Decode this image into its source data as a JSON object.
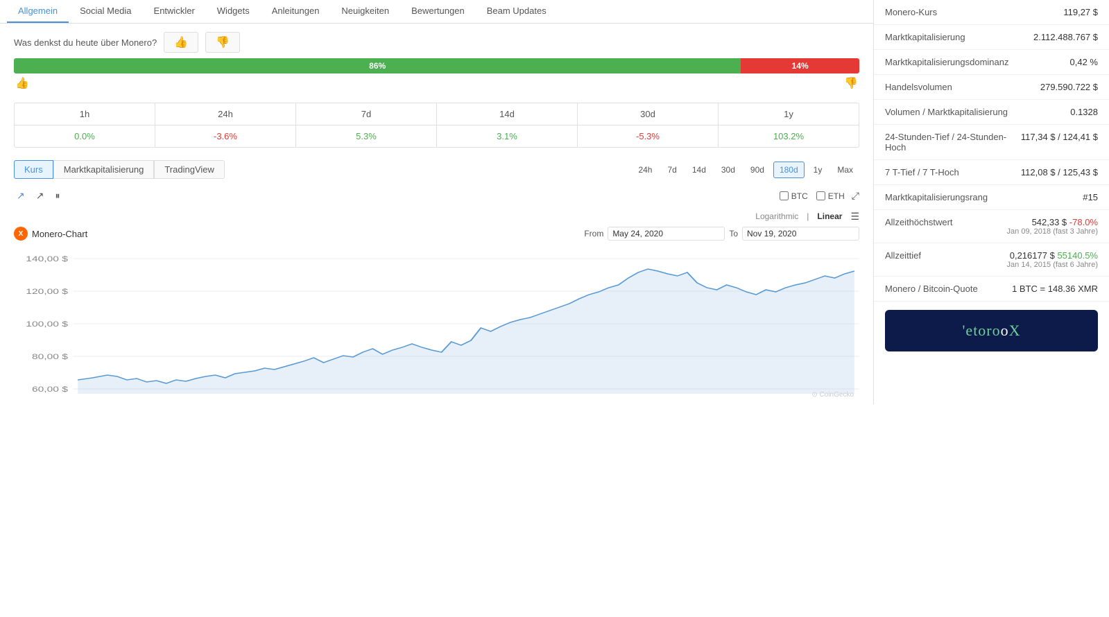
{
  "nav": {
    "tabs": [
      {
        "label": "Allgemein",
        "active": true
      },
      {
        "label": "Social Media",
        "active": false
      },
      {
        "label": "Entwickler",
        "active": false
      },
      {
        "label": "Widgets",
        "active": false
      },
      {
        "label": "Anleitungen",
        "active": false
      },
      {
        "label": "Neuigkeiten",
        "active": false
      },
      {
        "label": "Bewertungen",
        "active": false
      },
      {
        "label": "Beam Updates",
        "active": false
      }
    ]
  },
  "sentiment": {
    "question": "Was denkst du heute über Monero?",
    "thumbs_up": "👍",
    "thumbs_down": "👎",
    "positive_pct": "86%",
    "negative_pct": "14%",
    "green_width": 86,
    "red_width": 14
  },
  "price_changes": {
    "headers": [
      "1h",
      "24h",
      "7d",
      "14d",
      "30d",
      "1y"
    ],
    "values": [
      {
        "value": "0.0%",
        "type": "positive"
      },
      {
        "value": "-3.6%",
        "type": "negative"
      },
      {
        "value": "5.3%",
        "type": "positive"
      },
      {
        "value": "3.1%",
        "type": "positive"
      },
      {
        "value": "-5.3%",
        "type": "negative"
      },
      {
        "value": "103.2%",
        "type": "positive"
      }
    ]
  },
  "chart_tabs": {
    "items": [
      "Kurs",
      "Marktkapitalisierung",
      "TradingView"
    ]
  },
  "time_buttons": {
    "items": [
      "24h",
      "7d",
      "14d",
      "30d",
      "90d",
      "180d",
      "1y",
      "Max"
    ],
    "active": "180d"
  },
  "scale_buttons": {
    "logarithmic": "Logarithmic",
    "linear": "Linear",
    "active": "Linear"
  },
  "chart": {
    "title": "Monero-Chart",
    "from_label": "From",
    "to_label": "To",
    "from_date": "May 24, 2020",
    "to_date": "Nov 19, 2020",
    "y_labels": [
      "140,00 $",
      "120,00 $",
      "100,00 $",
      "80,00 $",
      "60,00 $"
    ],
    "btc_label": "BTC",
    "eth_label": "ETH"
  },
  "stats": {
    "items": [
      {
        "label": "Monero-Kurs",
        "value": "119,27 $",
        "sub": null,
        "value_class": null
      },
      {
        "label": "Marktkapitalisierung",
        "value": "2.112.488.767 $",
        "sub": null,
        "value_class": null
      },
      {
        "label": "Marktkapitalisierungsdominanz",
        "value": "0,42 %",
        "sub": null,
        "value_class": null
      },
      {
        "label": "Handelsvolumen",
        "value": "279.590.722 $",
        "sub": null,
        "value_class": null
      },
      {
        "label": "Volumen / Marktkapitalisierung",
        "value": "0.1328",
        "sub": null,
        "value_class": null
      },
      {
        "label": "24-Stunden-Tief / 24-Stunden-Hoch",
        "value": "117,34 $ / 124,41 $",
        "sub": null,
        "value_class": null
      },
      {
        "label": "7 T-Tief / 7 T-Hoch",
        "value": "112,08 $ / 125,43 $",
        "sub": null,
        "value_class": null
      },
      {
        "label": "Marktkapitalisierungsrang",
        "value": "#15",
        "sub": null,
        "value_class": null
      },
      {
        "label": "Allzeithöchstwert",
        "value": "542,33 $",
        "sub_pct": "-78.0%",
        "sub_pct_class": "negative-pct",
        "sub_date": "Jan 09, 2018 (fast 3 Jahre)",
        "value_class": null
      },
      {
        "label": "Allzeittief",
        "value": "0,216177 $",
        "sub_pct": "55140.5%",
        "sub_pct_class": "positive-pct",
        "sub_date": "Jan 14, 2015 (fast 6 Jahre)",
        "value_class": null
      },
      {
        "label": "Monero / Bitcoin-Quote",
        "value": "1 BTC = 148.36 XMR",
        "sub": null,
        "value_class": null
      }
    ]
  },
  "etoro": {
    "logo": "'etoro"
  }
}
